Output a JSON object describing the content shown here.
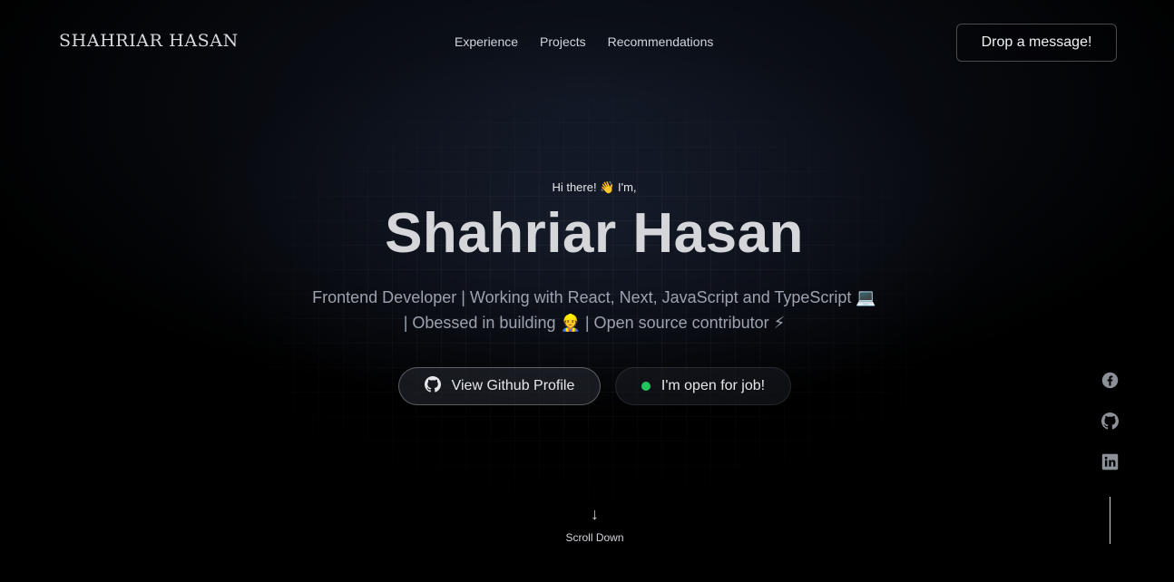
{
  "header": {
    "logo": "SHAHRIAR HASAN",
    "nav": [
      "Experience",
      "Projects",
      "Recommendations"
    ],
    "cta_label": "Drop a message!"
  },
  "hero": {
    "greeting": "Hi there! 👋 I'm,",
    "name": "Shahriar Hasan",
    "tagline_line1": "Frontend Developer | Working with React, Next, JavaScript and TypeScript 💻",
    "tagline_line2": "| Obessed in building 👷 | Open source contributor ⚡",
    "github_button": "View Github Profile",
    "job_button": "I'm open for job!"
  },
  "scroll": {
    "arrow": "↓",
    "label": "Scroll Down"
  },
  "social": {
    "icons": [
      "facebook-icon",
      "github-icon",
      "linkedin-icon"
    ]
  },
  "colors": {
    "background": "#000000",
    "status_green": "#22c55e",
    "accent_text": "#d4d6da"
  }
}
